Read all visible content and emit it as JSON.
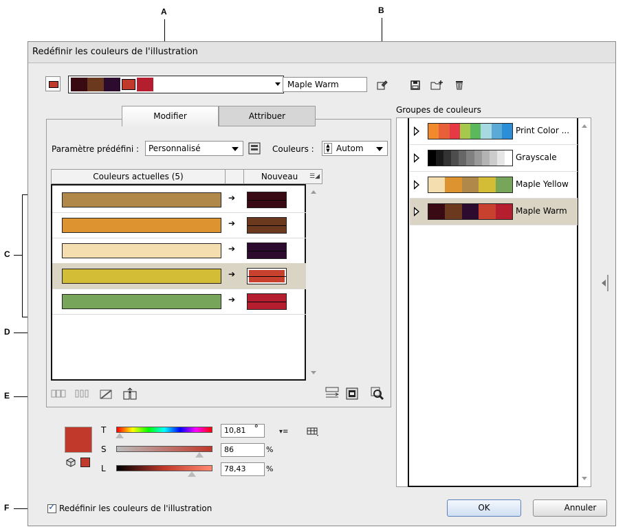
{
  "callouts": {
    "a": "A",
    "b": "B",
    "c": "C",
    "d": "D",
    "e": "E",
    "f": "F"
  },
  "title": "Redéfinir les couleurs de l'illustration",
  "top": {
    "active_swatch": "#c0392b",
    "group_colors": [
      "#3a0a12",
      "#6b3a1e",
      "#2d0b2e",
      "#c0392b",
      "#b51e2e"
    ],
    "group_name": "Maple Warm",
    "icons": [
      "eyedropper-icon",
      "save-icon",
      "new-group-icon",
      "delete-icon"
    ]
  },
  "tabs": {
    "modify": "Modifier",
    "assign": "Attribuer"
  },
  "preset_label": "Paramètre prédéfini :",
  "preset_value": "Personnalisé",
  "colors_label": "Couleurs :",
  "colors_value": "Autom",
  "table": {
    "header_current": "Couleurs actuelles (5)",
    "header_new": "Nouveau",
    "rows": [
      {
        "current": "#b0884a",
        "new": "#3a0a14",
        "selected": false
      },
      {
        "current": "#dd9430",
        "new": "#6b3a1e",
        "selected": false
      },
      {
        "current": "#f4deb0",
        "new": "#2d0b2e",
        "selected": false
      },
      {
        "current": "#d4bd36",
        "new": "#c8412e",
        "selected": true
      },
      {
        "current": "#77a55a",
        "new": "#b51e2e",
        "selected": false
      }
    ]
  },
  "groups_title": "Groupes de couleurs",
  "groups": [
    {
      "name": "Print Color ...",
      "colors": [
        "#f08a2c",
        "#e8603a",
        "#e63946",
        "#a6c84c",
        "#5cb85c",
        "#a6d9e0",
        "#5aa9d6",
        "#2d8ed8"
      ],
      "selected": false
    },
    {
      "name": "Grayscale",
      "colors": [
        "#000000",
        "#1a1a1a",
        "#333333",
        "#4d4d4d",
        "#666666",
        "#808080",
        "#999999",
        "#b3b3b3",
        "#cccccc",
        "#e6e6e6",
        "#ffffff"
      ],
      "selected": false
    },
    {
      "name": "Maple Yellow",
      "colors": [
        "#f4deb0",
        "#dd9430",
        "#b0884a",
        "#d4bd36",
        "#77a55a"
      ],
      "selected": false
    },
    {
      "name": "Maple Warm",
      "colors": [
        "#3a0a14",
        "#6b3a1e",
        "#2d0b2e",
        "#c8412e",
        "#b51e2e"
      ],
      "selected": true
    }
  ],
  "hsl": {
    "big_swatch": "#c0392b",
    "h_label": "T",
    "h_value": "10,81",
    "h_unit": "°",
    "h_fraction": 0.03,
    "s_label": "S",
    "s_value": "86",
    "s_unit": "%",
    "s_fraction": 0.86,
    "l_label": "L",
    "l_value": "78,43",
    "l_unit": "%",
    "l_fraction": 0.78
  },
  "checkbox": {
    "label": "Redéfinir les couleurs de l'illustration",
    "checked": true
  },
  "buttons": {
    "ok": "OK",
    "cancel": "Annuler"
  }
}
